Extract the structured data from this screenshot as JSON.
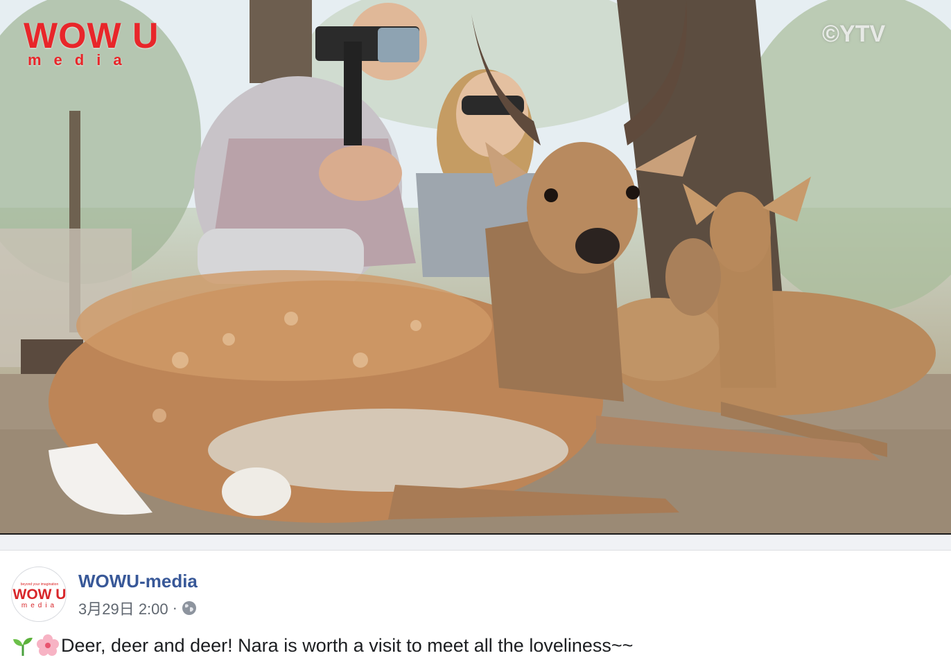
{
  "video": {
    "watermark_logo_main": "WOW U",
    "watermark_logo_sub": "media",
    "watermark_copyright": "©YTV"
  },
  "post": {
    "page_name": "WOWU-media",
    "timestamp": "3月29日 2:00",
    "separator": "·",
    "privacy_icon": "globe-icon",
    "avatar": {
      "tagline": "beyond your imagination",
      "logo_main": "WOW U",
      "logo_sub": "media"
    },
    "emojis": [
      "seedling-icon",
      "cherry-blossom-icon"
    ],
    "text": "Deer, deer and deer! Nara is worth a visit to meet all the loveliness~~"
  },
  "colors": {
    "page_name": "#385898",
    "meta_text": "#606770",
    "body_text": "#1c1e21",
    "brand_red": "#e8262a",
    "band_bg": "#f0f2f5"
  }
}
